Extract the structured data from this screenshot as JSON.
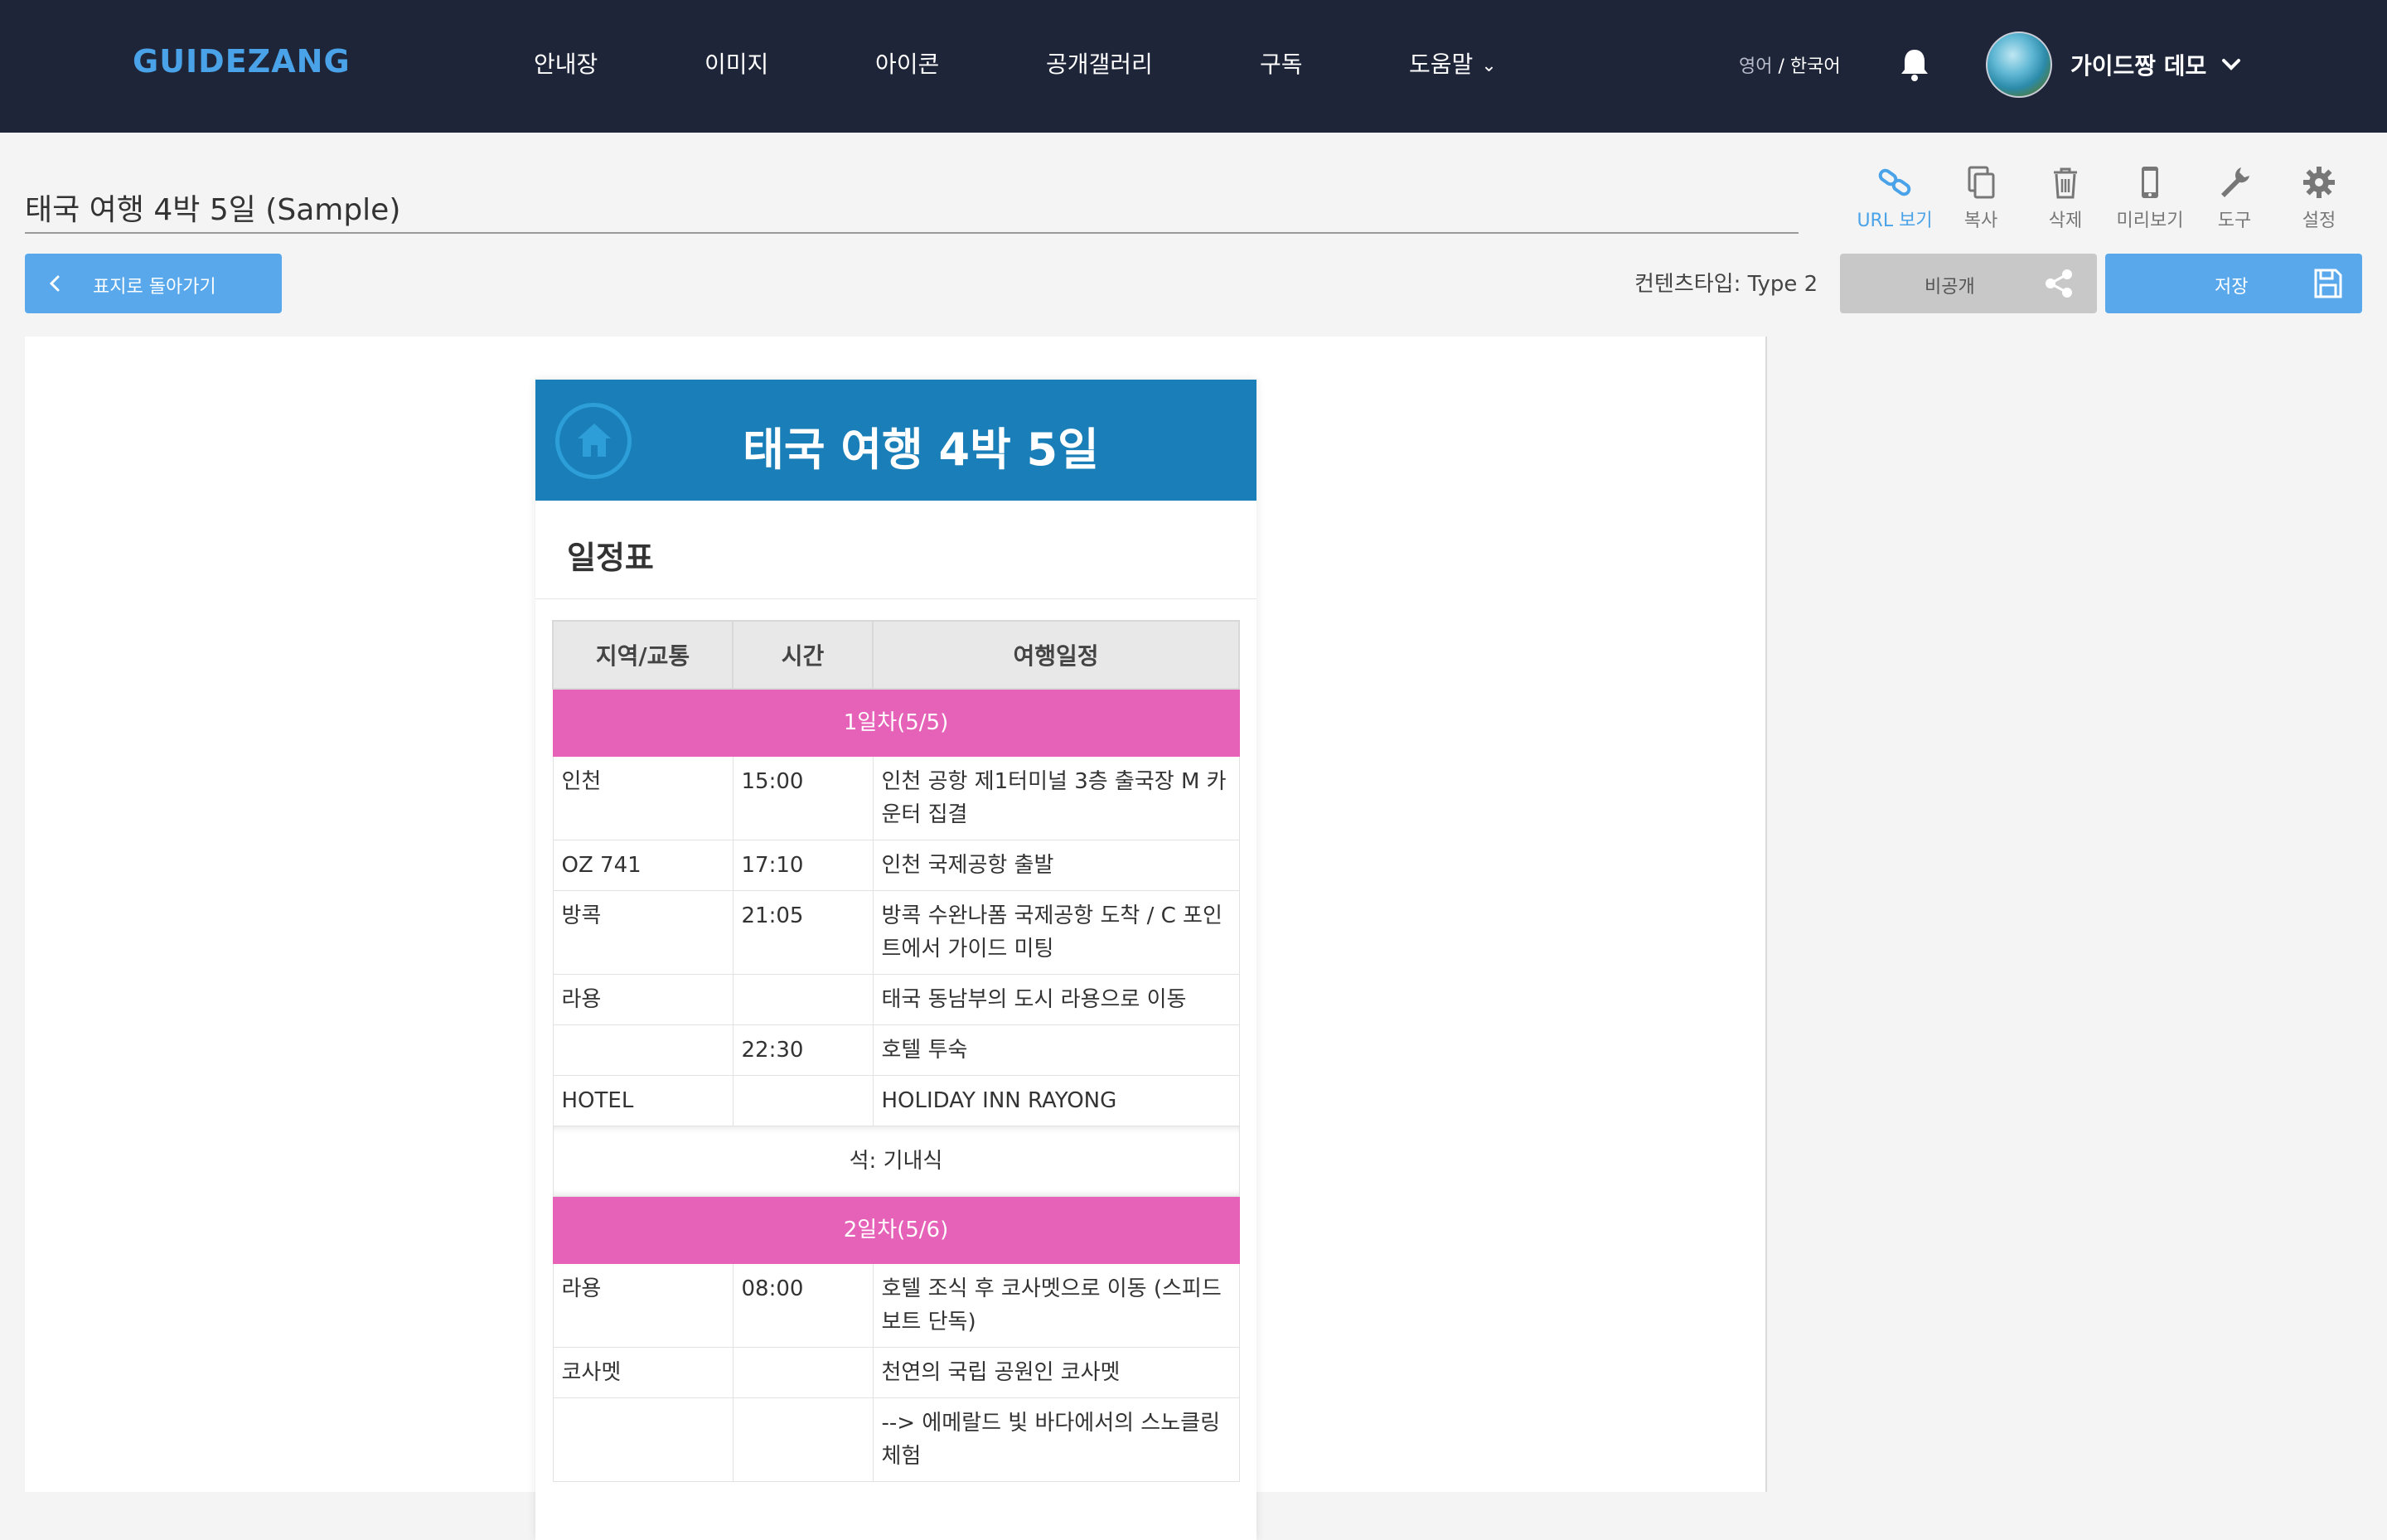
{
  "topbar": {
    "logo": "GUIDEZANG",
    "nav": [
      "안내장",
      "이미지",
      "아이콘",
      "공개갤러리",
      "구독",
      "도움말"
    ],
    "lang_other": "영어",
    "lang_sep": " / ",
    "lang_active": "한국어",
    "user_name": "가이드짱 데모"
  },
  "document": {
    "title": "태국 여행 4박 5일 (Sample)",
    "content_type": "컨텐츠타입: Type 2"
  },
  "tools": [
    {
      "label": "URL 보기",
      "icon": "link-icon",
      "active": true
    },
    {
      "label": "복사",
      "icon": "copy-icon"
    },
    {
      "label": "삭제",
      "icon": "trash-icon"
    },
    {
      "label": "미리보기",
      "icon": "mobile-icon"
    },
    {
      "label": "도구",
      "icon": "wrench-icon"
    },
    {
      "label": "설정",
      "icon": "gear-icon"
    }
  ],
  "buttons": {
    "back": "표지로 돌아가기",
    "private": "비공개",
    "save": "저장"
  },
  "card": {
    "title": "태국 여행 4박 5일",
    "section": "일정표",
    "headers": [
      "지역/교통",
      "시간",
      "여행일정"
    ],
    "day1": "1일차(5/5)",
    "rows1": [
      [
        "인천",
        "15:00",
        "인천 공항 제1터미널 3층 출국장 M 카운터 집결"
      ],
      [
        "OZ 741",
        "17:10",
        "인천 국제공항 출발"
      ],
      [
        "방콕",
        "21:05",
        "방콕 수완나폼 국제공항 도착 / C 포인트에서 가이드 미팅"
      ],
      [
        "라용",
        "",
        "태국 동남부의 도시 라용으로 이동"
      ],
      [
        "",
        "22:30",
        "호텔 투숙"
      ],
      [
        "HOTEL",
        "",
        "HOLIDAY INN RAYONG"
      ]
    ],
    "meal1": "석: 기내식",
    "day2": "2일차(5/6)",
    "rows2": [
      [
        "라용",
        "08:00",
        "호텔 조식 후 코사멧으로 이동 (스피드보트 단독)"
      ],
      [
        "코사멧",
        "",
        "천연의 국립 공원인 코사멧"
      ],
      [
        "",
        "",
        "--> 에메랄드 빛 바다에서의 스노클링 체험"
      ]
    ]
  },
  "colors": {
    "topbar": "#1e2538",
    "accent": "#59a8ec",
    "card_header": "#1a7fb8",
    "day_bar": "#e562b8"
  }
}
